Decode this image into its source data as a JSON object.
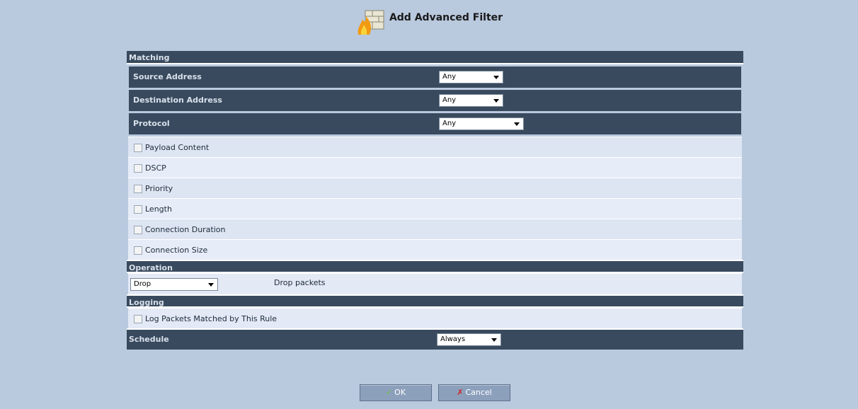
{
  "page": {
    "title": "Add Advanced Filter"
  },
  "matching": {
    "section_title": "Matching",
    "source_address": {
      "label": "Source Address",
      "value": "Any"
    },
    "destination_address": {
      "label": "Destination Address",
      "value": "Any"
    },
    "protocol": {
      "label": "Protocol",
      "value": "Any"
    },
    "options": [
      {
        "label": "Payload Content",
        "checked": false
      },
      {
        "label": "DSCP",
        "checked": false
      },
      {
        "label": "Priority",
        "checked": false
      },
      {
        "label": "Length",
        "checked": false
      },
      {
        "label": "Connection Duration",
        "checked": false
      },
      {
        "label": "Connection Size",
        "checked": false
      }
    ]
  },
  "operation": {
    "section_title": "Operation",
    "value": "Drop",
    "description": "Drop packets"
  },
  "logging": {
    "section_title": "Logging",
    "log_option": {
      "label": "Log Packets Matched by This Rule",
      "checked": false
    }
  },
  "schedule": {
    "label": "Schedule",
    "value": "Always"
  },
  "buttons": {
    "ok": "OK",
    "cancel": "Cancel"
  }
}
